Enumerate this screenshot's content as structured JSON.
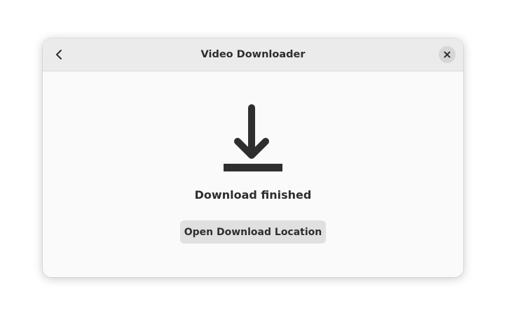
{
  "window": {
    "title": "Video Downloader"
  },
  "headerbar": {
    "back_icon": "go-previous-icon",
    "close_icon": "window-close-icon"
  },
  "content": {
    "icon": "download-icon",
    "status_text": "Download finished",
    "open_button_label": "Open Download Location"
  },
  "colors": {
    "headerbar_bg": "#ebebeb",
    "window_bg": "#fafafa",
    "button_bg": "#e0e0e0",
    "close_button_bg": "#d6d6d6",
    "text": "#2e2e2e"
  }
}
